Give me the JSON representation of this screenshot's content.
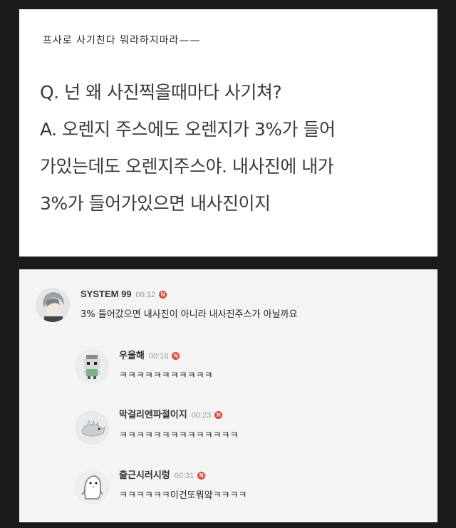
{
  "post": {
    "handwritten_note": "프사로 사기친다 뭐라하지마라——",
    "lines": [
      "Q. 넌 왜 사진찍을때마다 사기쳐?",
      "A. 오렌지 주스에도 오렌지가 3%가 들어",
      "가있는데도 오렌지주스야. 내사진에 내가",
      "3%가 들어가있으면 내사진이지"
    ]
  },
  "comments": [
    {
      "nick": "SYSTEM 99",
      "time": "00:12",
      "badge": "N",
      "text": "3% 들어갔으면 내사진이 아니라 내사진주스가 아닐까요",
      "avatar_icon": "anime-character-avatar"
    },
    {
      "nick": "우울해",
      "time": "00:18",
      "badge": "N",
      "text": "ㅋㅋㅋㅋㅋㅋㅋㅋㅋㅋㅋ",
      "avatar_icon": "pixel-character-avatar"
    },
    {
      "nick": "막걸리엔파절이지",
      "time": "00:23",
      "badge": "N",
      "text": "ㅋㅋㅋㅋㅋㅋㅋㅋㅋㅋㅋㅋㅋㅋ",
      "avatar_icon": "dinosaur-avatar"
    },
    {
      "nick": "출근시러시렁",
      "time": "00:31",
      "badge": "N",
      "text": "ㅋㅋㅋㅋㅋㅋ이건또뭐얔ㅋㅋㅋㅋ",
      "avatar_icon": "penguin-avatar"
    }
  ]
}
